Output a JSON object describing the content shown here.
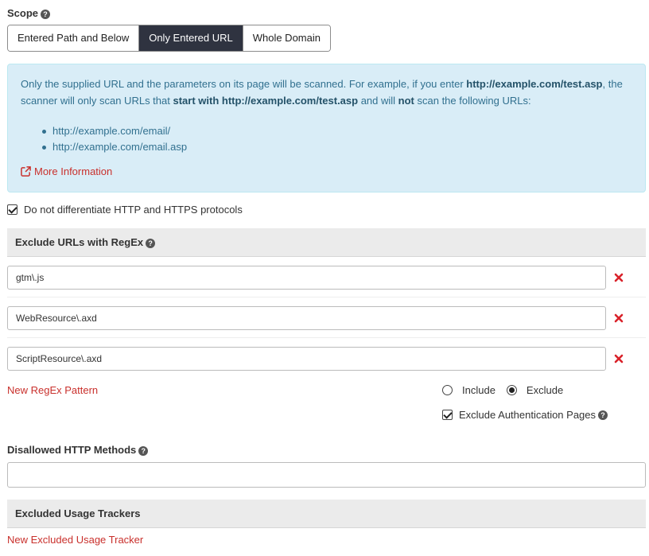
{
  "scope": {
    "label": "Scope",
    "options": [
      "Entered Path and Below",
      "Only Entered URL",
      "Whole Domain"
    ],
    "selected": "Only Entered URL"
  },
  "info": {
    "text_1": "Only the supplied URL and the parameters on its page will be scanned. For example, if you enter ",
    "url_1": "http://example.com/test.asp",
    "text_2": ", the scanner will only scan URLs that ",
    "bold_2": "start with http://example.com/test.asp",
    "text_3": " and will ",
    "bold_3": "not",
    "text_4": " scan the following URLs:",
    "examples": [
      "http://example.com/email/",
      "http://example.com/email.asp"
    ],
    "more_info": "More Information"
  },
  "protocol_checkbox": {
    "label": "Do not differentiate HTTP and HTTPS protocols",
    "checked": true
  },
  "exclude": {
    "header": "Exclude URLs with RegEx",
    "patterns": [
      "gtm\\.js",
      "WebResource\\.axd",
      "ScriptResource\\.axd"
    ],
    "new_pattern": "New RegEx Pattern",
    "include_label": "Include",
    "exclude_label": "Exclude",
    "mode": "Exclude",
    "auth_pages_label": "Exclude Authentication Pages",
    "auth_pages_checked": true
  },
  "http_methods": {
    "label": "Disallowed HTTP Methods",
    "value": ""
  },
  "trackers": {
    "header": "Excluded Usage Trackers",
    "new_tracker": "New Excluded Usage Tracker"
  },
  "colors": {
    "accent_dark": "#2f3340",
    "info_bg": "#d9edf7",
    "info_text": "#31708f",
    "link_red": "#c9302c",
    "remove_red": "#d9222a"
  }
}
